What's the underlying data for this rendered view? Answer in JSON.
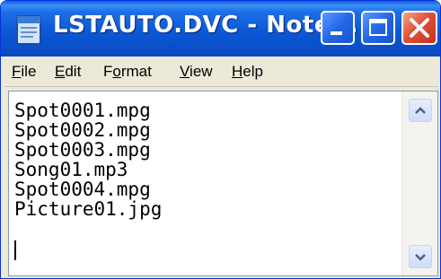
{
  "window": {
    "title": "LSTAUTO.DVC - Note..."
  },
  "menu": {
    "items": [
      {
        "label": "File",
        "mnemonic_index": 0
      },
      {
        "label": "Edit",
        "mnemonic_index": 0
      },
      {
        "label": "Format",
        "mnemonic_index": 1
      },
      {
        "label": "View",
        "mnemonic_index": 0
      },
      {
        "label": "Help",
        "mnemonic_index": 0
      }
    ]
  },
  "document": {
    "lines": [
      "Spot0001.mpg",
      "Spot0002.mpg",
      "Spot0003.mpg",
      "Song01.mp3",
      "Spot0004.mpg",
      "Picture01.jpg"
    ]
  },
  "icons": {
    "app": "notepad-icon",
    "minimize": "minimize-icon",
    "maximize": "maximize-icon",
    "close": "close-icon",
    "scroll_up": "chevron-up-icon",
    "scroll_down": "chevron-down-icon"
  },
  "colors": {
    "titlebar": "#0b58d6",
    "close_button": "#e0523a",
    "window_face": "#ece9d8"
  }
}
